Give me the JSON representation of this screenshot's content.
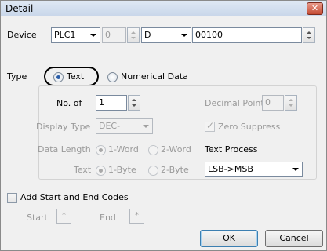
{
  "window": {
    "title": "Detail",
    "close_label": "✕"
  },
  "device": {
    "label": "Device",
    "plc_value": "PLC1",
    "station_value": "0",
    "device_type_value": "D",
    "address_value": "00100"
  },
  "type": {
    "label": "Type",
    "text_option": "Text",
    "numerical_option": "Numerical Data",
    "selected": "Text"
  },
  "no_of": {
    "label": "No. of",
    "value": "1"
  },
  "decimal_point": {
    "label": "Decimal Point",
    "value": "0"
  },
  "display_type": {
    "label": "Display Type",
    "value": "DEC-"
  },
  "zero_suppress": {
    "label": "Zero Suppress",
    "checked": true
  },
  "data_length": {
    "label": "Data Length",
    "option1": "1-Word",
    "option2": "2-Word",
    "selected": "1-Word"
  },
  "text_process": {
    "label": "Text Process",
    "value": "LSB->MSB"
  },
  "text": {
    "label": "Text",
    "option1": "1-Byte",
    "option2": "2-Byte",
    "selected": "1-Byte"
  },
  "codes": {
    "checkbox_label": "Add Start and End Codes",
    "start_label": "Start",
    "start_button": "*",
    "end_label": "End",
    "end_button": "*"
  },
  "buttons": {
    "ok": "OK",
    "cancel": "Cancel"
  }
}
